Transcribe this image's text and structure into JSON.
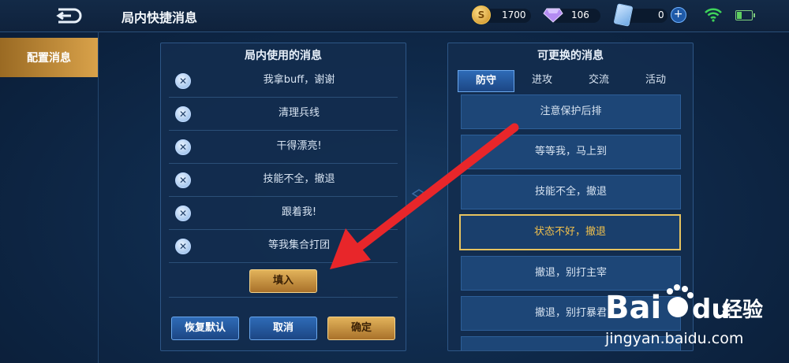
{
  "header": {
    "title": "局内快捷消息",
    "coin_symbol": "S",
    "coins": "1700",
    "gems": "106",
    "cards": "0",
    "plus_symbol": "+"
  },
  "sidebar": {
    "active_tab": "配置消息"
  },
  "left_panel": {
    "title": "局内使用的消息",
    "remove_symbol": "✕",
    "messages": [
      "我拿buff，谢谢",
      "清理兵线",
      "干得漂亮!",
      "技能不全，撤退",
      "跟着我!",
      "等我集合打团"
    ],
    "fill_button": "填入",
    "reset_button": "恢复默认",
    "cancel_button": "取消",
    "confirm_button": "确定"
  },
  "right_panel": {
    "title": "可更换的消息",
    "tabs": [
      "防守",
      "进攻",
      "交流",
      "活动"
    ],
    "active_tab_index": 0,
    "options": [
      "注意保护后排",
      "等等我，马上到",
      "技能不全，撤退",
      "状态不好，撤退",
      "撤退，别打主宰",
      "撤退，别打暴君"
    ],
    "selected_index": 3
  },
  "watermark": {
    "brand": "Bai",
    "brand_suffix": "du",
    "brand_cn": "经验",
    "url": "jingyan.baidu.com"
  },
  "colors": {
    "gold": "#e7c35f",
    "arrow": "#e8262a",
    "panel": "#122c4e"
  }
}
